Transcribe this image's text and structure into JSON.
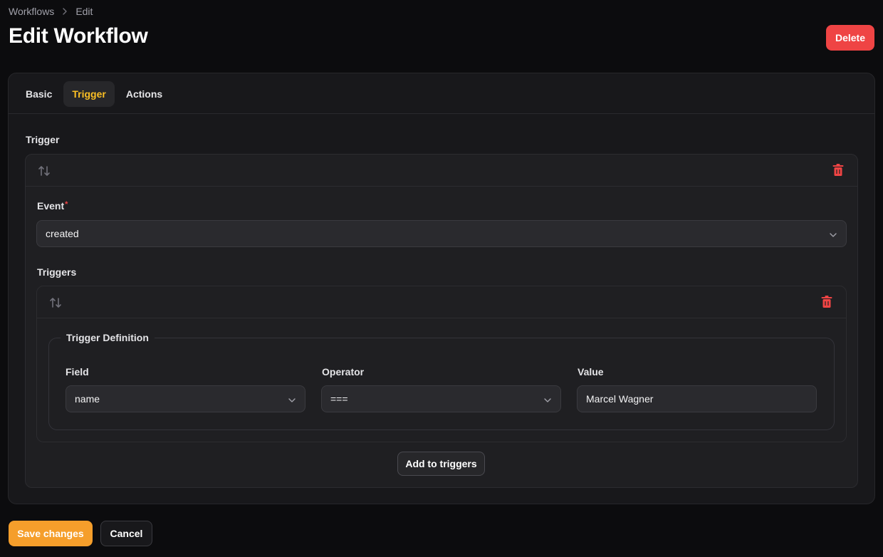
{
  "breadcrumb": {
    "items": [
      "Workflows",
      "Edit"
    ]
  },
  "page": {
    "title": "Edit Workflow",
    "delete_label": "Delete"
  },
  "tabs": [
    {
      "label": "Basic",
      "active": false
    },
    {
      "label": "Trigger",
      "active": true
    },
    {
      "label": "Actions",
      "active": false
    }
  ],
  "trigger_section": {
    "label": "Trigger",
    "event": {
      "label": "Event",
      "required_mark": "*",
      "value": "created"
    },
    "triggers": {
      "label": "Triggers",
      "definition": {
        "legend": "Trigger Definition",
        "field": {
          "label": "Field",
          "value": "name"
        },
        "operator": {
          "label": "Operator",
          "value": "==="
        },
        "value": {
          "label": "Value",
          "value": "Marcel Wagner"
        }
      },
      "add_label": "Add to triggers"
    }
  },
  "footer": {
    "save_label": "Save changes",
    "cancel_label": "Cancel"
  },
  "colors": {
    "accent": "#f59e2b",
    "active_tab": "#fbbf24",
    "danger": "#ef4444",
    "background": "#0c0c0e"
  },
  "icons": [
    "chevron-right-icon",
    "drag-sort-icon",
    "trash-icon",
    "chevron-down-icon"
  ]
}
